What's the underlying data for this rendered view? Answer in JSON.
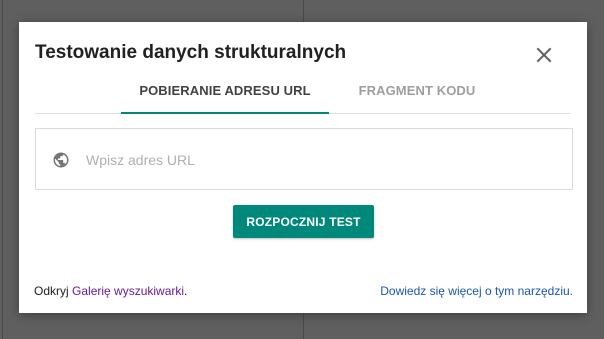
{
  "dialog": {
    "title": "Testowanie danych strukturalnych",
    "close_icon": "close-icon"
  },
  "tabs": [
    {
      "label": "POBIERANIE ADRESU URL",
      "active": true
    },
    {
      "label": "FRAGMENT KODU",
      "active": false
    }
  ],
  "url_field": {
    "icon": "globe-icon",
    "placeholder": "Wpisz adres URL",
    "value": ""
  },
  "start_button": {
    "label": "ROZPOCZNIJ TEST"
  },
  "footer": {
    "left_prefix": "Odkryj ",
    "left_link": "Galerię wyszukiwarki",
    "left_suffix": ".",
    "right_link": "Dowiedz się więcej o tym narzędziu."
  },
  "colors": {
    "accent": "#00897b",
    "link_visited": "#6a1b9a",
    "link": "#1a55b8",
    "overlay": "#5f5f5f"
  }
}
